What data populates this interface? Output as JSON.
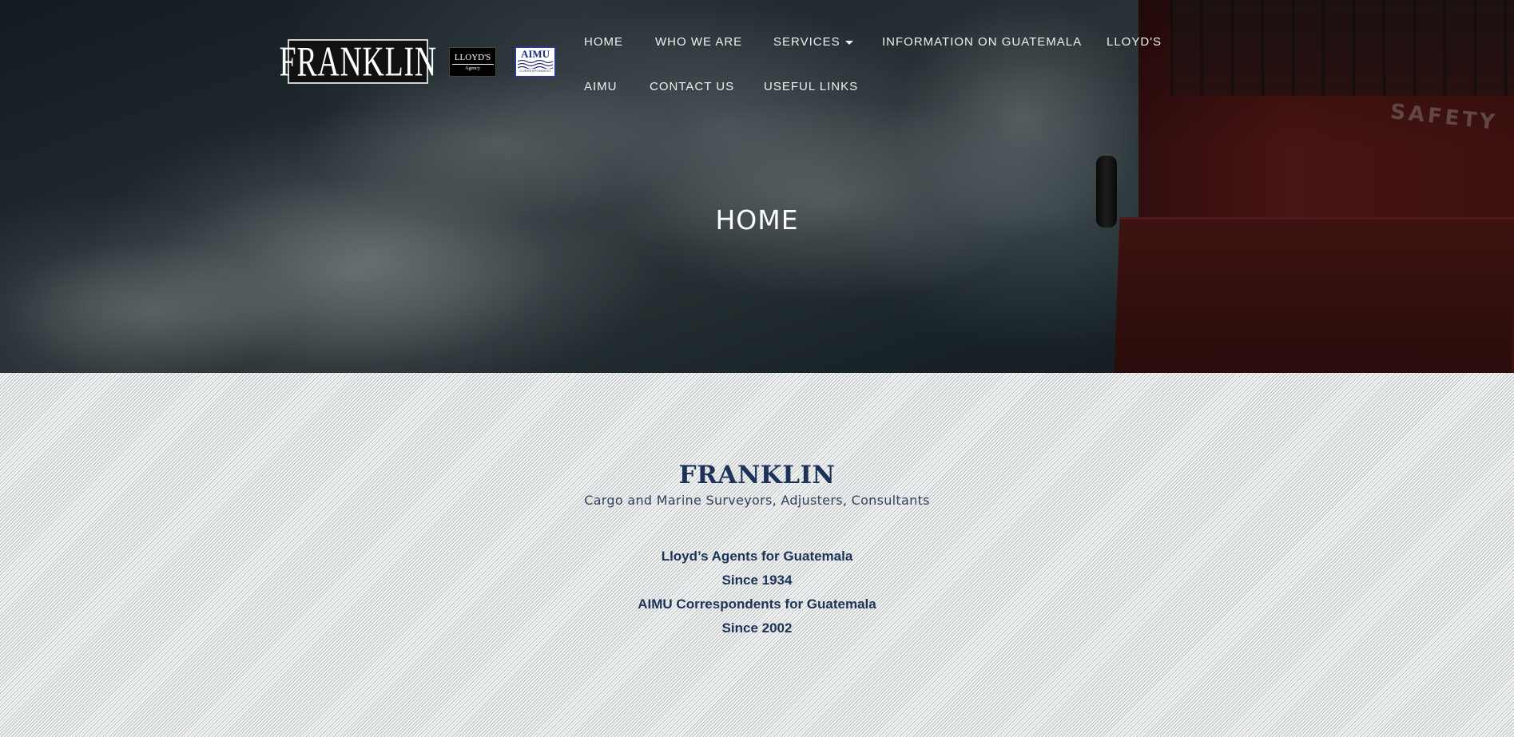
{
  "logos": {
    "franklin": "FRANKLIN",
    "lloyds_top": "LLOYD'S",
    "lloyds_bottom": "Agency",
    "aimu_top": "AIMU",
    "aimu_bottom": "CORRESPONDENT"
  },
  "nav": {
    "items": [
      {
        "label": "HOME"
      },
      {
        "label": "WHO WE ARE"
      },
      {
        "label": "SERVICES"
      },
      {
        "label": "INFORMATION ON GUATEMALA"
      },
      {
        "label": "LLOYD'S"
      },
      {
        "label": "AIMU"
      },
      {
        "label": "CONTACT US"
      },
      {
        "label": "USEFUL LINKS"
      }
    ]
  },
  "hero": {
    "title": "HOME",
    "ship_text": "SAFETY"
  },
  "main": {
    "brand": "FRANKLIN",
    "tagline": "Cargo and Marine Surveyors, Adjusters, Consultants",
    "facts": [
      "Lloyd’s Agents for Guatemala",
      "Since 1934",
      "AIMU Correspondents for Guatemala",
      "Since 2002"
    ]
  },
  "colors": {
    "brand_navy": "#1c3357",
    "nav_text": "#f0f0f0",
    "ship_red": "#6a1f1c"
  }
}
